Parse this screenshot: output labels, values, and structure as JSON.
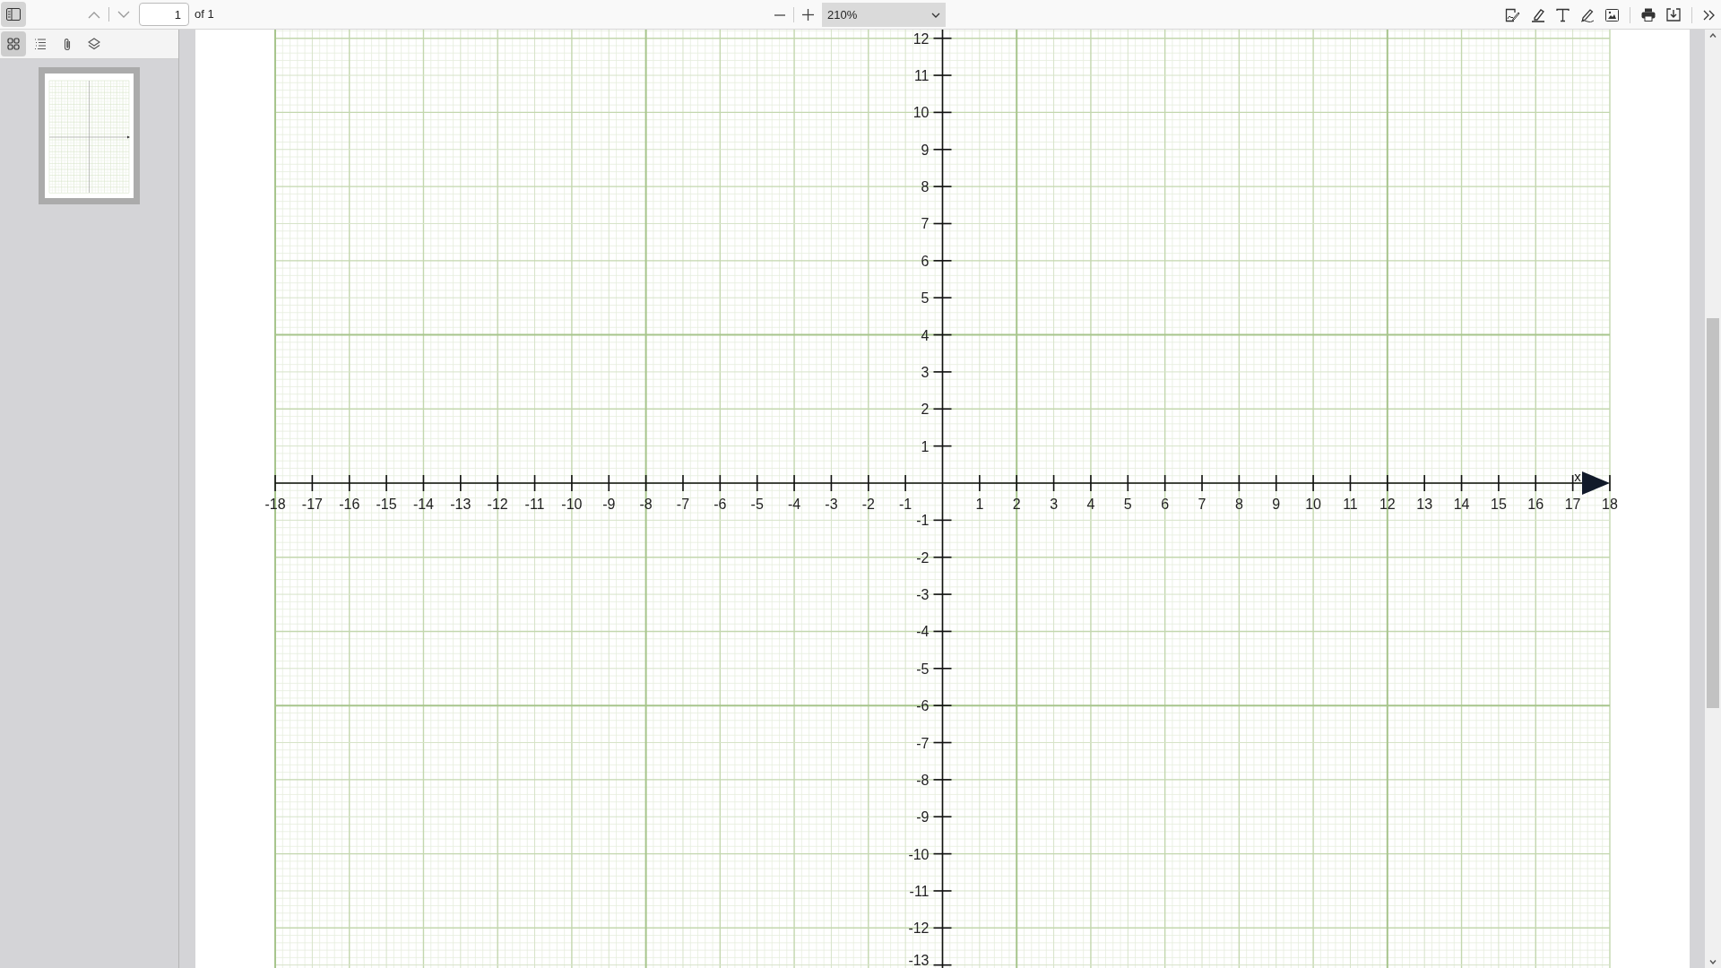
{
  "toolbar": {
    "sidebar_toggle": {
      "on": true
    },
    "page_number": "1",
    "page_count": "of 1",
    "zoom": "210%"
  },
  "sidebar": {
    "tabs": [
      {
        "kind": "thumbnails",
        "selected": true
      },
      {
        "kind": "outline",
        "selected": false
      },
      {
        "kind": "attachments",
        "selected": false
      },
      {
        "kind": "layers",
        "selected": false
      }
    ],
    "pages": [
      {
        "selected": true
      }
    ]
  },
  "graph": {
    "x_axis": {
      "label": "x",
      "ticks": [
        "-18",
        "-17",
        "-16",
        "-15",
        "-14",
        "-13",
        "-12",
        "-11",
        "-10",
        "-9",
        "-8",
        "-7",
        "-6",
        "-5",
        "-4",
        "-3",
        "-2",
        "-1",
        "1",
        "2",
        "3",
        "4",
        "5",
        "6",
        "7",
        "8",
        "9",
        "10",
        "11",
        "12",
        "13",
        "14",
        "15",
        "16",
        "17",
        "18"
      ]
    },
    "y_axis": {
      "ticks": [
        "12",
        "11",
        "10",
        "9",
        "8",
        "7",
        "6",
        "5",
        "4",
        "3",
        "2",
        "1",
        "-1",
        "-2",
        "-3",
        "-4",
        "-5",
        "-6",
        "-7",
        "-8",
        "-9",
        "-10",
        "-11",
        "-12",
        "-13"
      ]
    }
  }
}
